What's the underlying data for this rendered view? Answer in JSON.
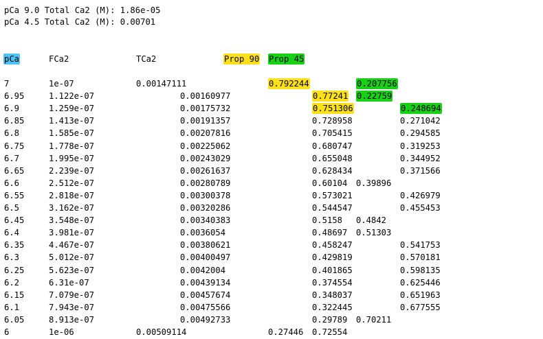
{
  "header": {
    "line1": "pCa 9.0 Total Ca2 (M): 1.86e-05",
    "line2": "pCa 4.5 Total Ca2 (M): 0.00701"
  },
  "columns": {
    "pca": "pCa",
    "fca2": "FCa2",
    "tca2": "TCa2",
    "prop90": "Prop 90",
    "prop45": "Prop 45"
  },
  "highlight_colors": {
    "pca_header": "#4fc3f7",
    "prop90": "#ffe01b",
    "prop45": "#16d116"
  },
  "rows": [
    {
      "pca": "7",
      "fca2": "1e-07",
      "tca2": "0.00147111",
      "p90": "0.792244",
      "p45": "0.207756"
    },
    {
      "pca": "6.95",
      "fca2": "1.122e-07",
      "tca2": "0.00160977",
      "p90": "0.77241",
      "p45": "0.22759"
    },
    {
      "pca": "6.9",
      "fca2": "1.259e-07",
      "tca2": "0.00175732",
      "p90": "0.751306",
      "p45": "0.248694"
    },
    {
      "pca": "6.85",
      "fca2": "1.413e-07",
      "tca2": "0.00191357",
      "p90": "0.728958",
      "p45": "0.271042"
    },
    {
      "pca": "6.8",
      "fca2": "1.585e-07",
      "tca2": "0.00207816",
      "p90": "0.705415",
      "p45": "0.294585"
    },
    {
      "pca": "6.75",
      "fca2": "1.778e-07",
      "tca2": "0.00225062",
      "p90": "0.680747",
      "p45": "0.319253"
    },
    {
      "pca": "6.7",
      "fca2": "1.995e-07",
      "tca2": "0.00243029",
      "p90": "0.655048",
      "p45": "0.344952"
    },
    {
      "pca": "6.65",
      "fca2": "2.239e-07",
      "tca2": "0.00261637",
      "p90": "0.628434",
      "p45": "0.371566"
    },
    {
      "pca": "6.6",
      "fca2": "2.512e-07",
      "tca2": "0.00280789",
      "p90": "0.60104",
      "p45": "0.39896"
    },
    {
      "pca": "6.55",
      "fca2": "2.818e-07",
      "tca2": "0.00300378",
      "p90": "0.573021",
      "p45": "0.426979"
    },
    {
      "pca": "6.5",
      "fca2": "3.162e-07",
      "tca2": "0.00320286",
      "p90": "0.544547",
      "p45": "0.455453"
    },
    {
      "pca": "6.45",
      "fca2": "3.548e-07",
      "tca2": "0.00340383",
      "p90": "0.5158",
      "p45": "0.4842"
    },
    {
      "pca": "6.4",
      "fca2": "3.981e-07",
      "tca2": "0.0036054",
      "p90": "0.48697",
      "p45": "0.51303"
    },
    {
      "pca": "6.35",
      "fca2": "4.467e-07",
      "tca2": "0.00380621",
      "p90": "0.458247",
      "p45": "0.541753"
    },
    {
      "pca": "6.3",
      "fca2": "5.012e-07",
      "tca2": "0.00400497",
      "p90": "0.429819",
      "p45": "0.570181"
    },
    {
      "pca": "6.25",
      "fca2": "5.623e-07",
      "tca2": "0.0042004",
      "p90": "0.401865",
      "p45": "0.598135"
    },
    {
      "pca": "6.2",
      "fca2": "6.31e-07",
      "tca2": "0.00439134",
      "p90": "0.374554",
      "p45": "0.625446"
    },
    {
      "pca": "6.15",
      "fca2": "7.079e-07",
      "tca2": "0.00457674",
      "p90": "0.348037",
      "p45": "0.651963"
    },
    {
      "pca": "6.1",
      "fca2": "7.943e-07",
      "tca2": "0.00475566",
      "p90": "0.322445",
      "p45": "0.677555"
    },
    {
      "pca": "6.05",
      "fca2": "8.913e-07",
      "tca2": "0.00492733",
      "p90": "0.29789",
      "p45": "0.70211"
    },
    {
      "pca": "6",
      "fca2": "1e-06",
      "tca2": "0.00509114",
      "p90": "0.27446",
      "p45": "0.72554"
    }
  ]
}
